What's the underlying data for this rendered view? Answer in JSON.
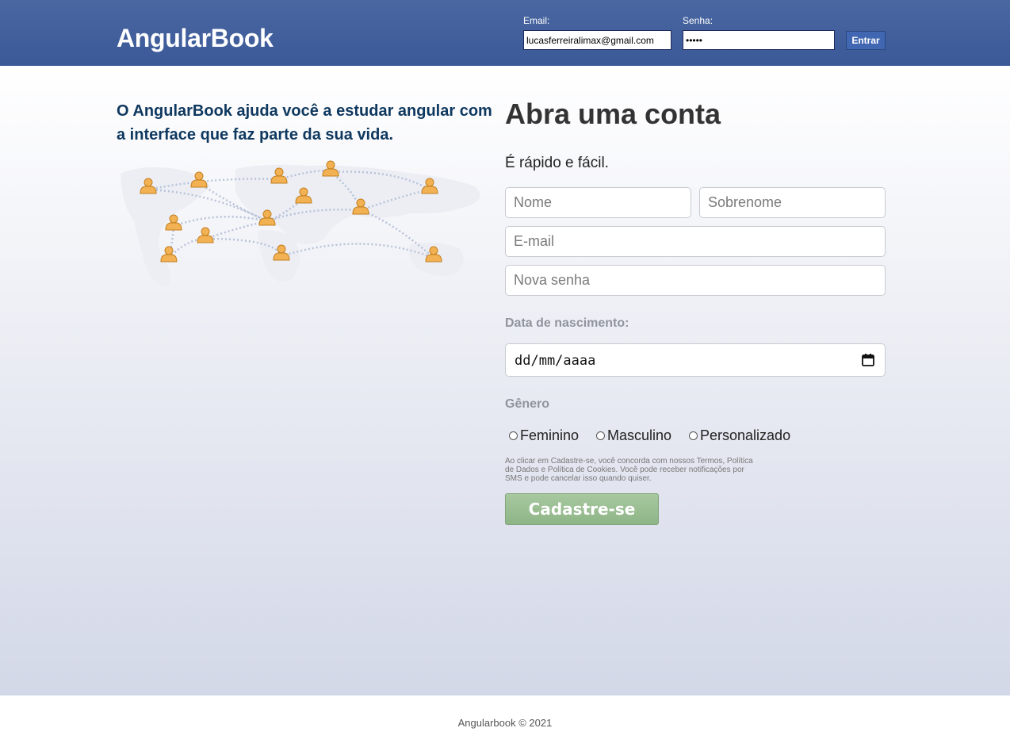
{
  "header": {
    "brand": "AngularBook",
    "email_label": "Email:",
    "email_value": "lucasferreiralimax@gmail.com",
    "password_label": "Senha:",
    "password_value": "•••••",
    "login_button": "Entrar"
  },
  "intro": {
    "tagline": "O AngularBook ajuda você a estudar angular com a interface que faz parte da sua vida."
  },
  "signup": {
    "title": "Abra uma conta",
    "subtitle": "É rápido e fácil.",
    "first_name_placeholder": "Nome",
    "last_name_placeholder": "Sobrenome",
    "email_placeholder": "E-mail",
    "password_placeholder": "Nova senha",
    "birth_label": "Data de nascimento:",
    "birth_value": "dd/mm/aaaa",
    "gender_label": "Gênero",
    "gender_options": [
      "Feminino",
      "Masculino",
      "Personalizado"
    ],
    "terms": "Ao clicar em Cadastre-se, você concorda com nossos Termos, Política de Dados e Política de Cookies. Você pode receber notificações por SMS e pode cancelar isso quando quiser.",
    "submit_button": "Cadastre-se"
  },
  "footer": {
    "text": "Angularbook © 2021"
  },
  "colors": {
    "header": "#3b5998",
    "tagline": "#0e385f",
    "submit": "#94bb8d"
  },
  "icons": [
    "world-map-people-icon",
    "calendar-icon"
  ]
}
